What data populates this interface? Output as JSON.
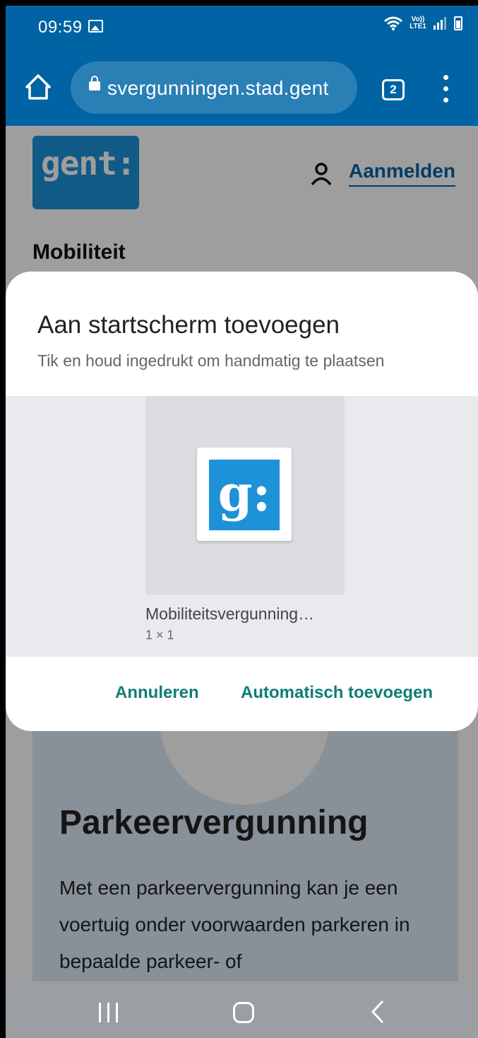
{
  "status_bar": {
    "time": "09:59",
    "network": "Vo)) LTE1"
  },
  "browser": {
    "url": "svergunningen.stad.gent",
    "tab_count": "2"
  },
  "page": {
    "logo_text": "gent:",
    "login_label": "Aanmelden",
    "section_title": "Mobiliteit",
    "card_title": "Parkeervergunning",
    "card_text": "Met een parkeervergunning kan je een voertuig onder voorwaarden parkeren in bepaalde parkeer- of"
  },
  "dialog": {
    "title": "Aan startscherm toevoegen",
    "subtitle": "Tik en houd ingedrukt om handmatig te plaatsen",
    "widget_icon_glyph": "g:",
    "widget_name": "Mobiliteitsvergunning…",
    "widget_size": "1 × 1",
    "cancel_label": "Annuleren",
    "add_label": "Automatisch toevoegen"
  },
  "colors": {
    "browser_blue": "#0063a3",
    "gent_blue": "#1e92d8",
    "dialog_button": "#0f7e75"
  }
}
